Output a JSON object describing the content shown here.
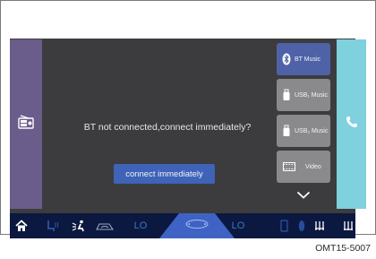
{
  "message": "BT not connected,connect immediately?",
  "connect_button": "connect immediately",
  "sources": [
    {
      "label": "BT Music",
      "icon": "bluetooth-icon",
      "active": true
    },
    {
      "label": "USB₁ Music",
      "icon": "usb-icon",
      "active": false
    },
    {
      "label": "USB₂ Music",
      "icon": "usb-icon",
      "active": false
    },
    {
      "label": "Video",
      "icon": "video-icon",
      "active": false
    }
  ],
  "bottom_bar": {
    "left_temp": "LO",
    "right_temp": "LO"
  },
  "caption": "OMT15-5007",
  "colors": {
    "screen": "#3c3c3e",
    "left_panel": "#6a5d8c",
    "right_panel": "#7fd1de",
    "accent": "#3e63b8",
    "bottom_bar": "#0b1840",
    "temp": "#3c78c8"
  }
}
